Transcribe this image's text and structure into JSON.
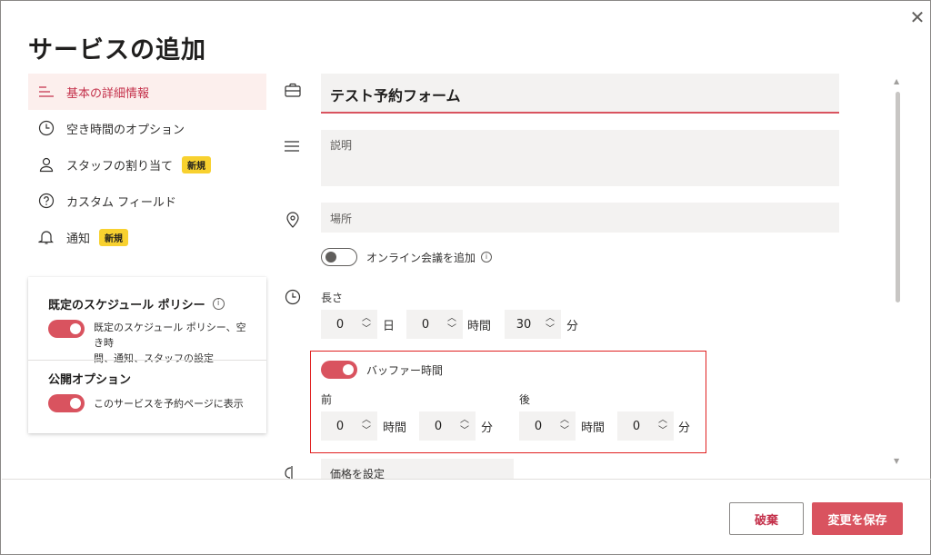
{
  "dialog": {
    "title": "サービスの追加",
    "close_glyph": "✕"
  },
  "sidebar": {
    "items": [
      {
        "label": "基本の詳細情報",
        "icon": "list-lines-icon",
        "active": true
      },
      {
        "label": "空き時間のオプション",
        "icon": "clock-icon"
      },
      {
        "label": "スタッフの割り当て",
        "icon": "person-icon",
        "badge": "新規"
      },
      {
        "label": "カスタム フィールド",
        "icon": "question-circle-icon"
      },
      {
        "label": "通知",
        "icon": "bell-icon",
        "badge": "新規"
      }
    ]
  },
  "policy_card": {
    "default_policy_title": "既定のスケジュール ポリシー",
    "default_policy_desc_line1": "既定のスケジュール ポリシー、空き時",
    "default_policy_desc_line2": "間、通知、スタッフの設定",
    "publish_title": "公開オプション",
    "publish_desc": "このサービスを予約ページに表示"
  },
  "form": {
    "service_name": "テスト予約フォーム",
    "description_placeholder": "説明",
    "location_placeholder": "場所",
    "online_meeting_label": "オンライン会議を追加",
    "duration": {
      "label": "長さ",
      "days": "0",
      "days_unit": "日",
      "hours": "0",
      "hours_unit": "時間",
      "minutes": "30",
      "minutes_unit": "分"
    },
    "buffer": {
      "label": "バッファー時間",
      "before_label": "前",
      "after_label": "後",
      "before_hours": "0",
      "before_minutes": "0",
      "after_hours": "0",
      "after_minutes": "0",
      "hours_unit": "時間",
      "minutes_unit": "分"
    },
    "price_label": "価格を設定"
  },
  "footer": {
    "discard_label": "破棄",
    "save_label": "変更を保存"
  },
  "colors": {
    "accent": "#d9535f",
    "badge": "#f8d12f",
    "highlight_box": "#e02020"
  }
}
